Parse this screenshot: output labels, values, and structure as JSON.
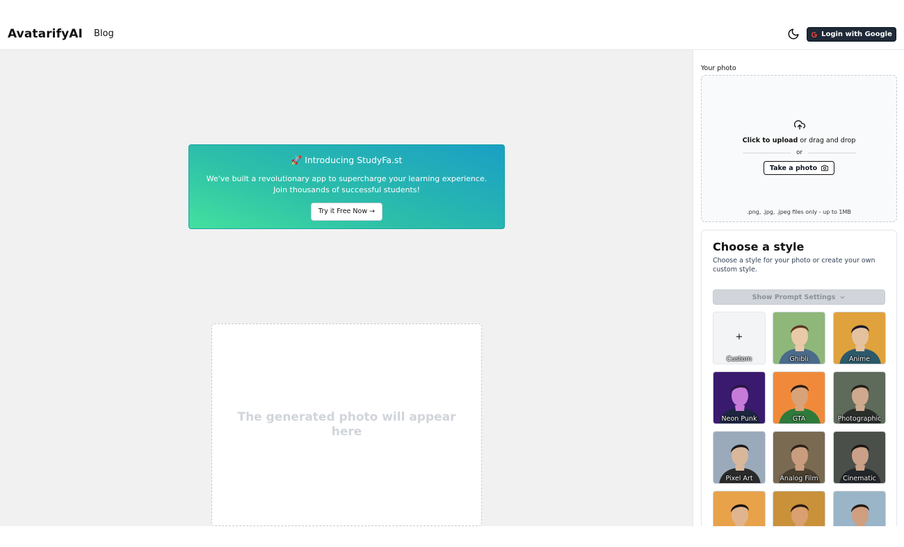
{
  "header": {
    "brand": "AvatarifyAI",
    "blog_label": "Blog",
    "theme_toggle_icon": "moon-icon",
    "login_label": "Login with Google"
  },
  "promo": {
    "title": "🚀 Introducing StudyFa.st",
    "description": "We've built a revolutionary app to supercharge your learning experience. Join thousands of successful students!",
    "cta_label": "Try it Free Now →",
    "gradient_colors": [
      "#43e09e",
      "#1a9fc5"
    ]
  },
  "result": {
    "placeholder": "The generated photo will appear here"
  },
  "upload": {
    "label": "Your photo",
    "click_text": "Click to upload",
    "drag_text": " or drag and drop",
    "or_text": "or",
    "take_photo_label": "Take a photo",
    "file_hint": ".png, .jpg, .jpeg files only - up to 1MB"
  },
  "styles": {
    "title": "Choose a style",
    "subtitle": "Choose a style for your photo or create your own custom style.",
    "prompt_settings_label": "Show Prompt Settings",
    "custom_symbol": "+",
    "items": [
      {
        "label": "Custom",
        "icon": "plus-icon"
      },
      {
        "label": "Ghibli",
        "bg": "#8fb77a",
        "accent": "#e9c9a8",
        "hair": "#5a3a22",
        "suit": "#4b6b8a"
      },
      {
        "label": "Anime",
        "bg": "#e0a23c",
        "accent": "#e4c2a0",
        "hair": "#1d1a2a",
        "suit": "#2c5a6a"
      },
      {
        "label": "Neon Punk",
        "bg": "#3a1a6e",
        "accent": "#c77bd9",
        "hair": "#2a1640",
        "suit": "#1d2540"
      },
      {
        "label": "GTA",
        "bg": "#f08a3a",
        "accent": "#d9a37a",
        "hair": "#2a1d14",
        "suit": "#2f7a3a"
      },
      {
        "label": "Photographic",
        "bg": "#5e6a5a",
        "accent": "#cfa98e",
        "hair": "#231d18",
        "suit": "#2a2e2a"
      },
      {
        "label": "Pixel Art",
        "bg": "#9aaabb",
        "accent": "#d8b79a",
        "hair": "#1a1a1a",
        "suit": "#2a2a2a"
      },
      {
        "label": "Analog Film",
        "bg": "#7a6a52",
        "accent": "#c99c7e",
        "hair": "#2a2018",
        "suit": "#4a4030"
      },
      {
        "label": "Cinematic",
        "bg": "#4a4f4a",
        "accent": "#caa088",
        "hair": "#1a1612",
        "suit": "#23262a"
      },
      {
        "label": "",
        "bg": "#e7a24a",
        "accent": "#e0b48e",
        "hair": "#1a1410",
        "suit": "#3a5a6a"
      },
      {
        "label": "",
        "bg": "#c9913a",
        "accent": "#d9a070",
        "hair": "#2a1a10",
        "suit": "#2a3a5a"
      },
      {
        "label": "",
        "bg": "#9ab4c8",
        "accent": "#cf9f80",
        "hair": "#241a14",
        "suit": "#5a3a2a"
      }
    ]
  }
}
